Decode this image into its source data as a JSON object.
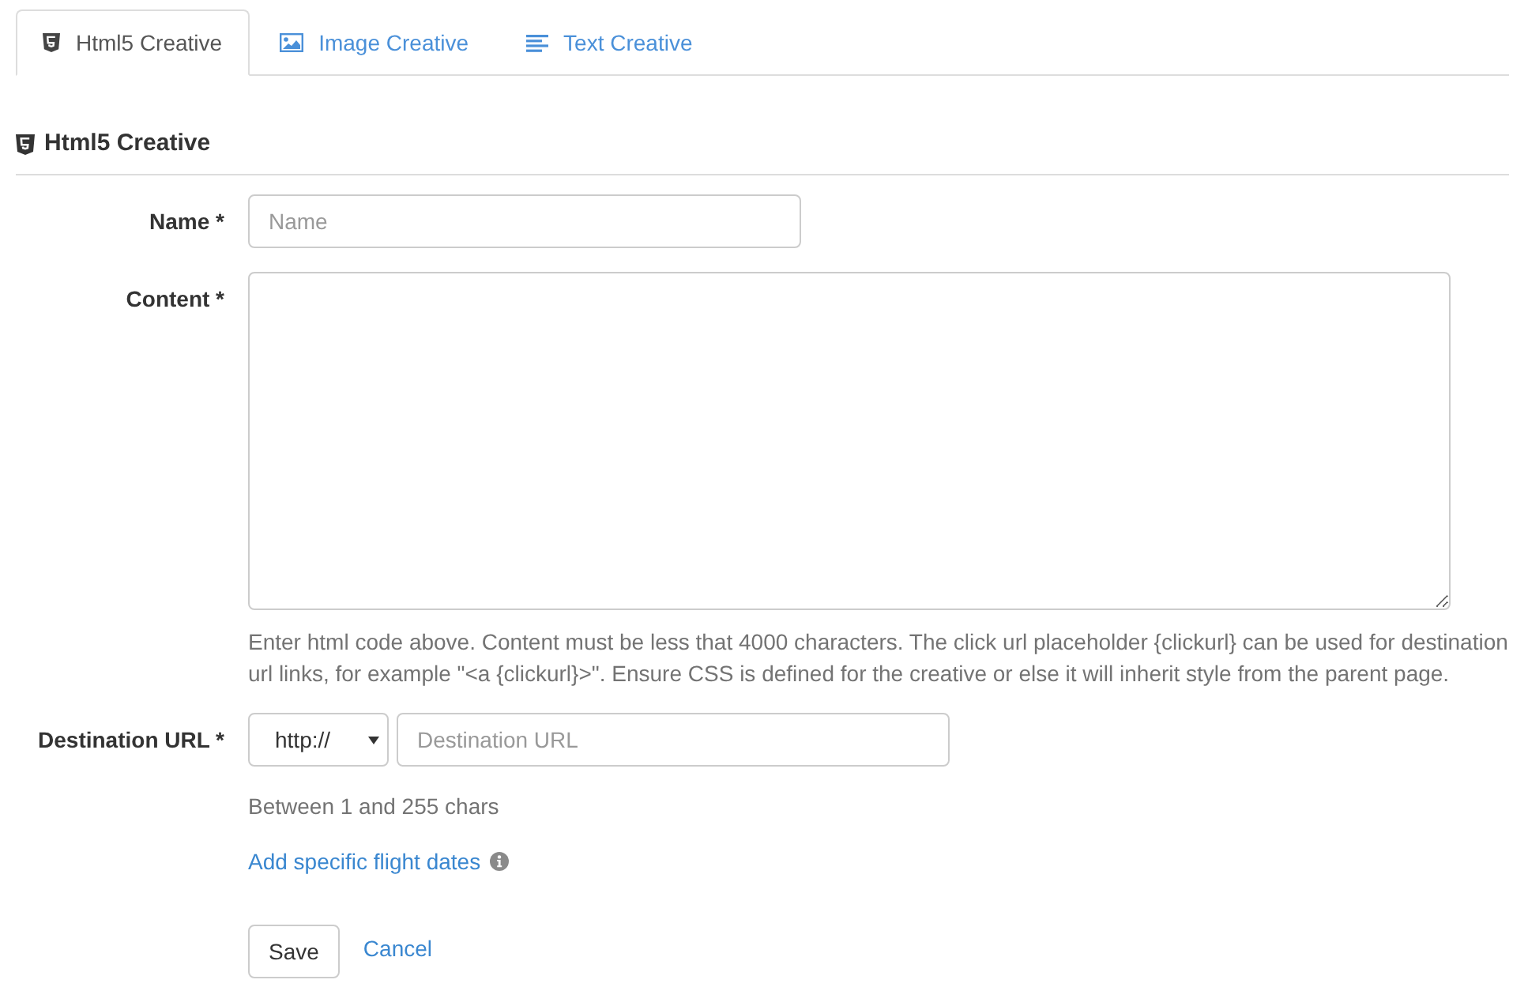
{
  "tabs": [
    {
      "label": "Html5 Creative",
      "kind": "html5",
      "selected": true
    },
    {
      "label": "Image Creative",
      "kind": "image",
      "selected": false
    },
    {
      "label": "Text Creative",
      "kind": "text",
      "selected": false
    }
  ],
  "heading": {
    "title": "Html5 Creative"
  },
  "fields": [
    {
      "kind": "text",
      "label": "Name *",
      "placeholder": "Name"
    },
    {
      "kind": "textarea",
      "label": "Content *",
      "help": "Enter html code above. Content must be less that 4000 characters. The click url placeholder {clickurl} can be used for destination url links, for example \"<a {clickurl}>\". Ensure CSS is defined for the creative or else it will inherit style from the parent page."
    },
    {
      "kind": "url",
      "label": "Destination URL *",
      "protocol": "http://",
      "placeholder": "Destination URL",
      "help": "Between 1 and 255 chars"
    }
  ],
  "flight_dates_link": "Add specific flight dates",
  "buttons": {
    "save": "Save",
    "cancel": "Cancel"
  }
}
